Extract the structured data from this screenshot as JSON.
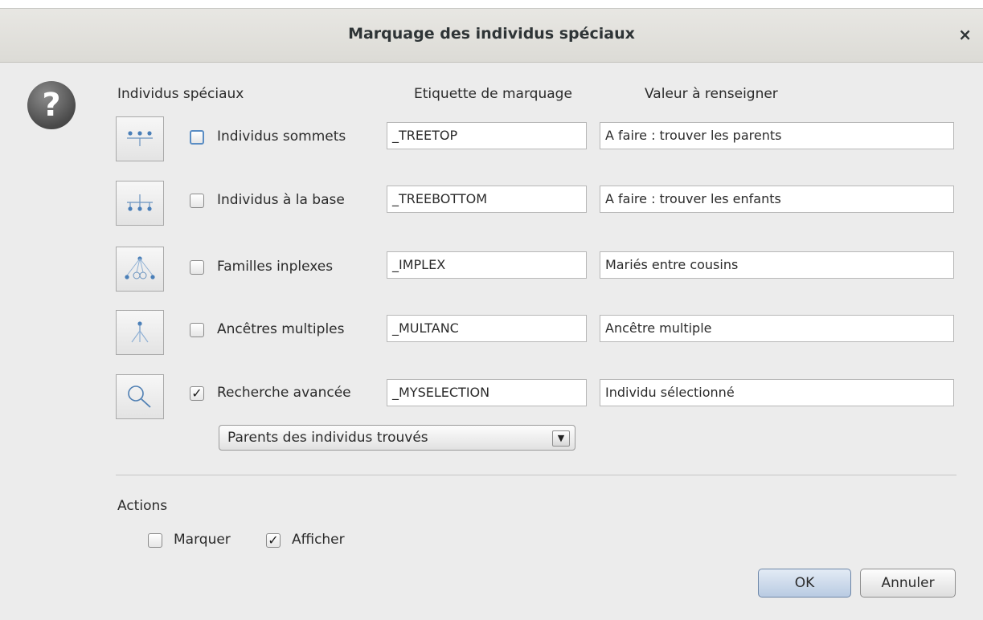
{
  "window": {
    "title": "Marquage des individus spéciaux",
    "close_glyph": "×"
  },
  "headers": {
    "special": "Individus spéciaux",
    "tag": "Etiquette de marquage",
    "value": "Valeur à renseigner"
  },
  "rows": [
    {
      "icon": "tree-top-icon",
      "checked": false,
      "label": "Individus sommets",
      "tag": "_TREETOP",
      "value": "A faire : trouver les parents"
    },
    {
      "icon": "tree-bottom-icon",
      "checked": false,
      "label": "Individus à la base",
      "tag": "_TREEBOTTOM",
      "value": "A faire : trouver les enfants"
    },
    {
      "icon": "implex-icon",
      "checked": false,
      "label": "Familles inplexes",
      "tag": "_IMPLEX",
      "value": "Mariés entre cousins"
    },
    {
      "icon": "multiple-ancestor-icon",
      "checked": false,
      "label": "Ancêtres multiples",
      "tag": "_MULTANC",
      "value": "Ancêtre multiple"
    },
    {
      "icon": "search-icon",
      "checked": true,
      "label": "Recherche avancée",
      "tag": "_MYSELECTION",
      "value": "Individu sélectionné"
    }
  ],
  "search_scope": {
    "selected": "Parents des individus trouvés"
  },
  "actions": {
    "heading": "Actions",
    "mark": {
      "label": "Marquer",
      "checked": false
    },
    "show": {
      "label": "Afficher",
      "checked": true
    }
  },
  "buttons": {
    "ok": "OK",
    "cancel": "Annuler"
  },
  "glyphs": {
    "check": "✓",
    "dropdown": "▼",
    "question": "?"
  }
}
